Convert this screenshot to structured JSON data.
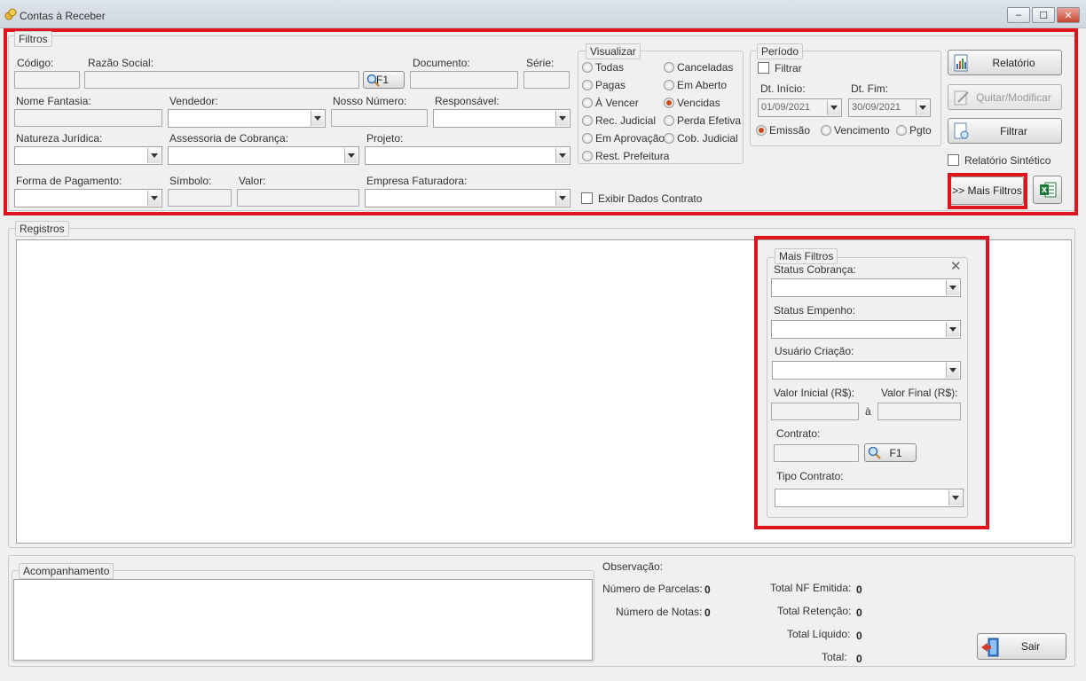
{
  "window": {
    "title": "Contas à Receber",
    "minimize": "–",
    "maximize": "☐",
    "close": "✕"
  },
  "filtros": {
    "legend": "Filtros",
    "codigo_label": "Código:",
    "razao_social_label": "Razão Social:",
    "f1_label": "F1",
    "documento_label": "Documento:",
    "serie_label": "Série:",
    "nome_fantasia_label": "Nome Fantasia:",
    "vendedor_label": "Vendedor:",
    "nosso_numero_label": "Nosso Número:",
    "responsavel_label": "Responsável:",
    "natureza_label": "Natureza Jurídica:",
    "assessoria_label": "Assessoria de Cobrança:",
    "projeto_label": "Projeto:",
    "forma_pagamento_label": "Forma de Pagamento:",
    "simbolo_label": "Símbolo:",
    "valor_label": "Valor:",
    "empresa_label": "Empresa Faturadora:",
    "exibir_contrato_label": "Exibir Dados Contrato"
  },
  "visualizar": {
    "legend": "Visualizar",
    "options": [
      {
        "label": "Todas",
        "selected": false
      },
      {
        "label": "Canceladas",
        "selected": false
      },
      {
        "label": "Pagas",
        "selected": false
      },
      {
        "label": "Em Aberto",
        "selected": false
      },
      {
        "label": "À Vencer",
        "selected": false
      },
      {
        "label": "Vencidas",
        "selected": true
      },
      {
        "label": "Rec. Judicial",
        "selected": false
      },
      {
        "label": "Perda Efetiva",
        "selected": false
      },
      {
        "label": "Em Aprovação",
        "selected": false
      },
      {
        "label": "Cob. Judicial",
        "selected": false
      },
      {
        "label": "Rest. Prefeitura",
        "selected": false
      }
    ]
  },
  "periodo": {
    "legend": "Período",
    "filtrar_label": "Filtrar",
    "dt_inicio_label": "Dt. Início:",
    "dt_fim_label": "Dt. Fim:",
    "dt_inicio_value": "01/09/2021",
    "dt_fim_value": "30/09/2021",
    "emissao_label": "Emissão",
    "vencimento_label": "Vencimento",
    "pgto_label": "Pgto"
  },
  "actions": {
    "relatorio_label": "Relatório",
    "quitar_label": "Quitar/Modificar",
    "filtrar_label": "Filtrar",
    "relatorio_sintetico_label": "Relatório Sintético",
    "mais_filtros_label": ">> Mais Filtros"
  },
  "registros": {
    "legend": "Registros"
  },
  "mais_filtros": {
    "legend": "Mais Filtros",
    "status_cobranca_label": "Status Cobrança:",
    "status_empenho_label": "Status Empenho:",
    "usuario_criacao_label": "Usuário Criação:",
    "valor_inicial_label": "Valor Inicial (R$):",
    "valor_final_label": "Valor Final (R$):",
    "a_label": "à",
    "contrato_label": "Contrato:",
    "f1_label": "F1",
    "tipo_contrato_label": "Tipo Contrato:"
  },
  "acompanhamento": {
    "legend": "Acompanhamento"
  },
  "resumo": {
    "observacao_label": "Observação:",
    "num_parcelas_label": "Número de Parcelas:",
    "num_parcelas_value": "0",
    "num_notas_label": "Número de Notas:",
    "num_notas_value": "0",
    "total_nf_label": "Total NF Emitida:",
    "total_nf_value": "0",
    "total_retencao_label": "Total Retenção:",
    "total_retencao_value": "0",
    "total_liquido_label": "Total Líquido:",
    "total_liquido_value": "0",
    "total_label": "Total:",
    "total_value": "0"
  },
  "sair_label": "Sair",
  "colors": {
    "highlight": "#e0141e",
    "radio_selected": "#c84a1a"
  }
}
